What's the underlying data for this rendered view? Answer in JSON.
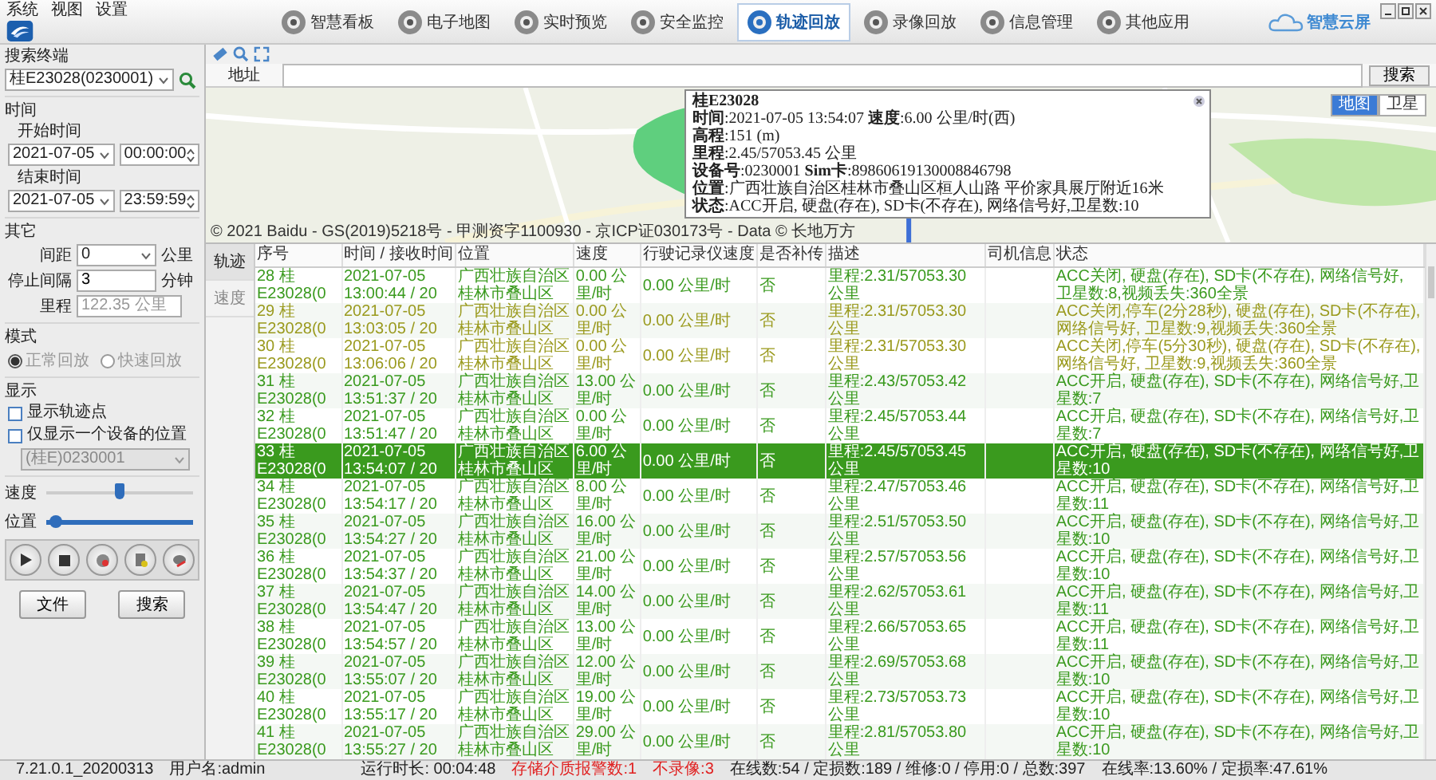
{
  "menu": [
    "系统",
    "视图",
    "设置"
  ],
  "nav": [
    {
      "label": "智慧看板",
      "selected": false
    },
    {
      "label": "电子地图",
      "selected": false
    },
    {
      "label": "实时预览",
      "selected": false
    },
    {
      "label": "安全监控",
      "selected": false
    },
    {
      "label": "轨迹回放",
      "selected": true
    },
    {
      "label": "录像回放",
      "selected": false
    },
    {
      "label": "信息管理",
      "selected": false
    },
    {
      "label": "其他应用",
      "selected": false
    }
  ],
  "brand": "智慧云屏",
  "sidebar": {
    "search_label": "搜索终端",
    "terminal": "桂E23028(0230001)",
    "time_label": "时间",
    "start": {
      "label": "开始时间",
      "date": "2021-07-05",
      "time": "00:00:00"
    },
    "end": {
      "label": "结束时间",
      "date": "2021-07-05",
      "time": "23:59:59"
    },
    "other_label": "其它",
    "spacing": {
      "label": "间距",
      "value": "0",
      "unit": "公里"
    },
    "stop": {
      "label": "停止间隔",
      "value": "3",
      "unit": "分钟"
    },
    "mileage": {
      "label": "里程",
      "value": "122.35 公里"
    },
    "mode_label": "模式",
    "modes": [
      {
        "label": "正常回放",
        "selected": true,
        "disabled": true
      },
      {
        "label": "快速回放",
        "selected": false,
        "disabled": true
      }
    ],
    "display_label": "显示",
    "options": [
      {
        "label": "显示轨迹点",
        "checked": false
      },
      {
        "label": "仅显示一个设备的位置",
        "checked": false
      }
    ],
    "device_select": {
      "value": "(桂E)0230001",
      "disabled": true
    },
    "speed": {
      "label": "速度",
      "level": 0.5
    },
    "position": {
      "label": "位置",
      "level": 0.06
    },
    "buttons": [
      "文件",
      "搜索"
    ]
  },
  "map": {
    "address_label": "地址",
    "search_button": "搜索",
    "types": [
      {
        "label": "地图",
        "selected": true
      },
      {
        "label": "卫星",
        "selected": false
      }
    ],
    "copyright": "© 2021 Baidu - GS(2019)5218号 - 甲测资字1100930 - 京ICP证030173号 - Data © 长地万方",
    "popup": {
      "title": "桂E23028",
      "lines": [
        "**时间**:2021-07-05 13:54:07 **速度**:6.00 公里/时(西)",
        "**高程**:151 (m)",
        "**里程**:2.45/57053.45 公里",
        "**设备号**:0230001 **Sim卡**:89860619130008846798",
        "**位置**:广西壮族自治区桂林市叠山区桓人山路 平价家具展厅附近16米",
        "**状态**:ACC开启, 硬盘(存在), SD卡(不存在), 网络信号好,卫星数:10"
      ]
    }
  },
  "tabs": [
    {
      "label": "轨迹",
      "selected": true
    },
    {
      "label": "速度",
      "selected": false
    }
  ],
  "table": {
    "columns": [
      "序号",
      "时间 / 接收时间",
      "位置",
      "速度",
      "行驶记录仪速度",
      "是否补传",
      "描述",
      "司机信息",
      "状态"
    ],
    "rows": [
      {
        "index": "28 桂E23028(0",
        "time": "2021-07-05 13:00:44 / 20",
        "position": "广西壮族自治区桂林市叠山区",
        "speed": "0.00 公里/时",
        "recorder_speed": "0.00 公里/时",
        "resent": "否",
        "description": "里程:2.31/57053.30 公里",
        "status": "ACC关闭, 硬盘(存在), SD卡(不存在), 网络信号好, 卫星数:8,视频丢失:360全景",
        "color": "#3a9a1e",
        "selected": false
      },
      {
        "index": "29 桂E23028(0",
        "time": "2021-07-05 13:03:05 / 20",
        "position": "广西壮族自治区桂林市叠山区",
        "speed": "0.00 公里/时",
        "recorder_speed": "0.00 公里/时",
        "resent": "否",
        "description": "里程:2.31/57053.30 公里",
        "status": "ACC关闭,停车(2分28秒), 硬盘(存在), SD卡(不存在), 网络信号好, 卫星数:9,视频丢失:360全景",
        "color": "#9a9a1e",
        "selected": false
      },
      {
        "index": "30 桂E23028(0",
        "time": "2021-07-05 13:06:06 / 20",
        "position": "广西壮族自治区桂林市叠山区",
        "speed": "0.00 公里/时",
        "recorder_speed": "0.00 公里/时",
        "resent": "否",
        "description": "里程:2.31/57053.30 公里",
        "status": "ACC关闭,停车(5分30秒), 硬盘(存在), SD卡(不存在), 网络信号好, 卫星数:9,视频丢失:360全景",
        "color": "#9a9a1e",
        "selected": false
      },
      {
        "index": "31 桂E23028(0",
        "time": "2021-07-05 13:51:37 / 20",
        "position": "广西壮族自治区桂林市叠山区",
        "speed": "13.00 公里/时",
        "recorder_speed": "0.00 公里/时",
        "resent": "否",
        "description": "里程:2.43/57053.42 公里",
        "status": "ACC开启, 硬盘(存在), SD卡(不存在), 网络信号好,卫星数:7",
        "color": "#3a9a1e",
        "selected": false
      },
      {
        "index": "32 桂E23028(0",
        "time": "2021-07-05 13:51:47 / 20",
        "position": "广西壮族自治区桂林市叠山区",
        "speed": "0.00 公里/时",
        "recorder_speed": "0.00 公里/时",
        "resent": "否",
        "description": "里程:2.45/57053.44 公里",
        "status": "ACC开启, 硬盘(存在), SD卡(不存在), 网络信号好,卫星数:7",
        "color": "#3a9a1e",
        "selected": false
      },
      {
        "index": "33 桂E23028(0",
        "time": "2021-07-05 13:54:07 / 20",
        "position": "广西壮族自治区桂林市叠山区",
        "speed": "6.00 公里/时",
        "recorder_speed": "0.00 公里/时",
        "resent": "否",
        "description": "里程:2.45/57053.45 公里",
        "status": "ACC开启, 硬盘(存在), SD卡(不存在), 网络信号好,卫星数:10",
        "color": "#3a9a1e",
        "selected": true
      },
      {
        "index": "34 桂E23028(0",
        "time": "2021-07-05 13:54:17 / 20",
        "position": "广西壮族自治区桂林市叠山区",
        "speed": "8.00 公里/时",
        "recorder_speed": "0.00 公里/时",
        "resent": "否",
        "description": "里程:2.47/57053.46 公里",
        "status": "ACC开启, 硬盘(存在), SD卡(不存在), 网络信号好,卫星数:11",
        "color": "#3a9a1e",
        "selected": false
      },
      {
        "index": "35 桂E23028(0",
        "time": "2021-07-05 13:54:27 / 20",
        "position": "广西壮族自治区桂林市叠山区",
        "speed": "16.00 公里/时",
        "recorder_speed": "0.00 公里/时",
        "resent": "否",
        "description": "里程:2.51/57053.50 公里",
        "status": "ACC开启, 硬盘(存在), SD卡(不存在), 网络信号好,卫星数:10",
        "color": "#3a9a1e",
        "selected": false
      },
      {
        "index": "36 桂E23028(0",
        "time": "2021-07-05 13:54:37 / 20",
        "position": "广西壮族自治区桂林市叠山区",
        "speed": "21.00 公里/时",
        "recorder_speed": "0.00 公里/时",
        "resent": "否",
        "description": "里程:2.57/57053.56 公里",
        "status": "ACC开启, 硬盘(存在), SD卡(不存在), 网络信号好,卫星数:10",
        "color": "#3a9a1e",
        "selected": false
      },
      {
        "index": "37 桂E23028(0",
        "time": "2021-07-05 13:54:47 / 20",
        "position": "广西壮族自治区桂林市叠山区",
        "speed": "14.00 公里/时",
        "recorder_speed": "0.00 公里/时",
        "resent": "否",
        "description": "里程:2.62/57053.61 公里",
        "status": "ACC开启, 硬盘(存在), SD卡(不存在), 网络信号好,卫星数:11",
        "color": "#3a9a1e",
        "selected": false
      },
      {
        "index": "38 桂E23028(0",
        "time": "2021-07-05 13:54:57 / 20",
        "position": "广西壮族自治区桂林市叠山区",
        "speed": "13.00 公里/时",
        "recorder_speed": "0.00 公里/时",
        "resent": "否",
        "description": "里程:2.66/57053.65 公里",
        "status": "ACC开启, 硬盘(存在), SD卡(不存在), 网络信号好,卫星数:11",
        "color": "#3a9a1e",
        "selected": false
      },
      {
        "index": "39 桂E23028(0",
        "time": "2021-07-05 13:55:07 / 20",
        "position": "广西壮族自治区桂林市叠山区",
        "speed": "12.00 公里/时",
        "recorder_speed": "0.00 公里/时",
        "resent": "否",
        "description": "里程:2.69/57053.68 公里",
        "status": "ACC开启, 硬盘(存在), SD卡(不存在), 网络信号好,卫星数:10",
        "color": "#3a9a1e",
        "selected": false
      },
      {
        "index": "40 桂E23028(0",
        "time": "2021-07-05 13:55:17 / 20",
        "position": "广西壮族自治区桂林市叠山区",
        "speed": "19.00 公里/时",
        "recorder_speed": "0.00 公里/时",
        "resent": "否",
        "description": "里程:2.73/57053.73 公里",
        "status": "ACC开启, 硬盘(存在), SD卡(不存在), 网络信号好,卫星数:10",
        "color": "#3a9a1e",
        "selected": false
      },
      {
        "index": "41 桂E23028(0",
        "time": "2021-07-05 13:55:27 / 20",
        "position": "广西壮族自治区桂林市叠山区",
        "speed": "29.00 公里/时",
        "recorder_speed": "0.00 公里/时",
        "resent": "否",
        "description": "里程:2.81/57053.80 公里",
        "status": "ACC开启, 硬盘(存在), SD卡(不存在), 网络信号好,卫星数:10",
        "color": "#3a9a1e",
        "selected": false
      }
    ]
  },
  "status_bar": {
    "version": "7.21.0.1_20200313",
    "user": "用户名:admin",
    "items": [
      {
        "text": "运行时长: 00:04:48",
        "alert": false
      },
      {
        "text": "存储介质报警数:1",
        "alert": true
      },
      {
        "text": "不录像:3",
        "alert": true
      },
      {
        "text": "在线数:54 / 定损数:189 / 维修:0 / 停用:0 / 总数:397",
        "alert": false
      },
      {
        "text": "在线率:13.60% / 定损率:47.61%",
        "alert": false
      }
    ]
  }
}
